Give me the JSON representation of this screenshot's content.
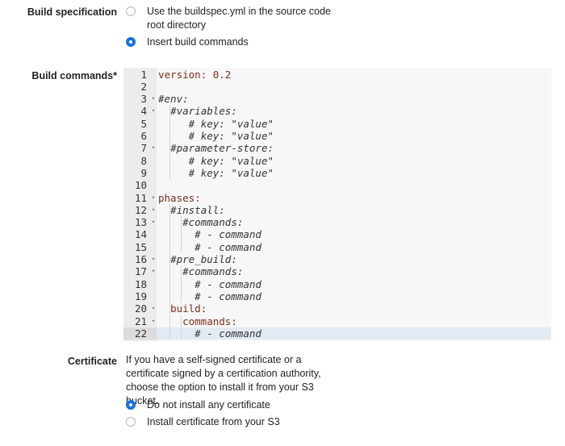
{
  "build_spec": {
    "label": "Build specification",
    "options": [
      {
        "text": "Use the buildspec.yml in the source code root directory",
        "checked": false
      },
      {
        "text": "Insert build commands",
        "checked": true
      }
    ]
  },
  "build_commands": {
    "label": "Build commands*",
    "lines": [
      {
        "n": "1",
        "fold": "",
        "indent": "",
        "text": "version: 0.2",
        "style": "key"
      },
      {
        "n": "2",
        "fold": "",
        "indent": "",
        "text": "",
        "style": "key"
      },
      {
        "n": "3",
        "fold": "▾",
        "indent": "",
        "text": "#env:",
        "style": "comment"
      },
      {
        "n": "4",
        "fold": "▾",
        "indent": "  ",
        "text": "#variables:",
        "style": "comment"
      },
      {
        "n": "5",
        "fold": "",
        "indent": "     ",
        "text": "# key: \"value\"",
        "style": "comment"
      },
      {
        "n": "6",
        "fold": "",
        "indent": "     ",
        "text": "# key: \"value\"",
        "style": "comment"
      },
      {
        "n": "7",
        "fold": "▾",
        "indent": "  ",
        "text": "#parameter-store:",
        "style": "comment"
      },
      {
        "n": "8",
        "fold": "",
        "indent": "     ",
        "text": "# key: \"value\"",
        "style": "comment"
      },
      {
        "n": "9",
        "fold": "",
        "indent": "     ",
        "text": "# key: \"value\"",
        "style": "comment"
      },
      {
        "n": "10",
        "fold": "",
        "indent": "",
        "text": "",
        "style": "key"
      },
      {
        "n": "11",
        "fold": "▾",
        "indent": "",
        "text": "phases:",
        "style": "key"
      },
      {
        "n": "12",
        "fold": "▾",
        "indent": "  ",
        "text": "#install:",
        "style": "comment"
      },
      {
        "n": "13",
        "fold": "▾",
        "indent": "    ",
        "text": "#commands:",
        "style": "comment"
      },
      {
        "n": "14",
        "fold": "",
        "indent": "      ",
        "text": "# - command",
        "style": "comment"
      },
      {
        "n": "15",
        "fold": "",
        "indent": "      ",
        "text": "# - command",
        "style": "comment"
      },
      {
        "n": "16",
        "fold": "▾",
        "indent": "  ",
        "text": "#pre_build:",
        "style": "comment"
      },
      {
        "n": "17",
        "fold": "▾",
        "indent": "    ",
        "text": "#commands:",
        "style": "comment"
      },
      {
        "n": "18",
        "fold": "",
        "indent": "      ",
        "text": "# - command",
        "style": "comment"
      },
      {
        "n": "19",
        "fold": "",
        "indent": "      ",
        "text": "# - command",
        "style": "comment"
      },
      {
        "n": "20",
        "fold": "▾",
        "indent": "  ",
        "text": "build:",
        "style": "key"
      },
      {
        "n": "21",
        "fold": "▾",
        "indent": "    ",
        "text": "commands:",
        "style": "key"
      },
      {
        "n": "22",
        "fold": "",
        "indent": "      ",
        "text": "# - command",
        "style": "comment"
      }
    ],
    "active_line": "22"
  },
  "certificate": {
    "label": "Certificate",
    "description": "If you have a self-signed certificate or a certificate signed by a certification authority, choose the option to install it from your S3 bucket.",
    "options": [
      {
        "text": "Do not install any certificate",
        "checked": true
      },
      {
        "text": "Install certificate from your S3",
        "checked": false
      }
    ]
  },
  "colors": {
    "accent": "#1a6fd6",
    "editor_bg": "#f7f7f7",
    "gutter_bg": "#ececec",
    "active_line_bg": "#e3eaf3"
  }
}
